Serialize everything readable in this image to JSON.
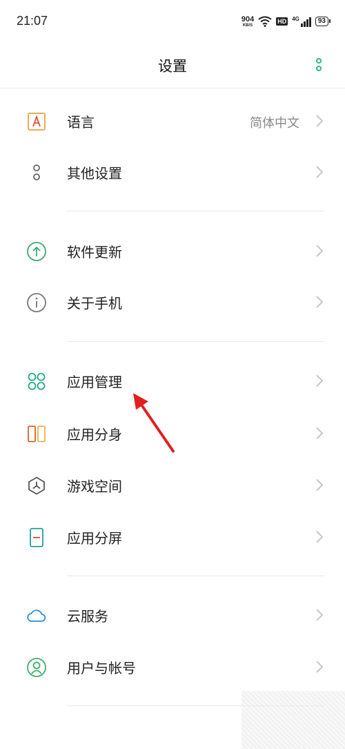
{
  "status_bar": {
    "time": "21:07",
    "net_speed_value": "904",
    "net_speed_unit": "KB/S",
    "hd_label": "HD",
    "signal_label": "4G",
    "battery": "93"
  },
  "header": {
    "title": "设置",
    "more_icon": "more-vertical-icon"
  },
  "items": [
    {
      "id": "language",
      "label": "语言",
      "value": "简体中文",
      "icon": "language-icon"
    },
    {
      "id": "other-settings",
      "label": "其他设置",
      "icon": "other-settings-icon"
    },
    {
      "id": "software-update",
      "label": "软件更新",
      "icon": "update-icon"
    },
    {
      "id": "about-phone",
      "label": "关于手机",
      "icon": "info-icon"
    },
    {
      "id": "app-management",
      "label": "应用管理",
      "icon": "app-grid-icon"
    },
    {
      "id": "app-clone",
      "label": "应用分身",
      "icon": "app-clone-icon"
    },
    {
      "id": "game-space",
      "label": "游戏空间",
      "icon": "game-space-icon"
    },
    {
      "id": "split-screen",
      "label": "应用分屏",
      "icon": "split-screen-icon"
    },
    {
      "id": "cloud-service",
      "label": "云服务",
      "icon": "cloud-icon"
    },
    {
      "id": "user-account",
      "label": "用户与帐号",
      "icon": "user-icon"
    }
  ],
  "colors": {
    "accent_green": "#34b38a",
    "language_icon": "#e8a33c",
    "update_icon": "#3fa86b",
    "info_icon": "#777777",
    "app_grid_icon": "#1fa98a",
    "clone_left": "#d9622b",
    "clone_right": "#e6b24a",
    "split_icon": "#1fa29a",
    "cloud_icon": "#2a8fc9",
    "user_icon": "#3fae6a",
    "annotation_arrow": "#e02020"
  }
}
